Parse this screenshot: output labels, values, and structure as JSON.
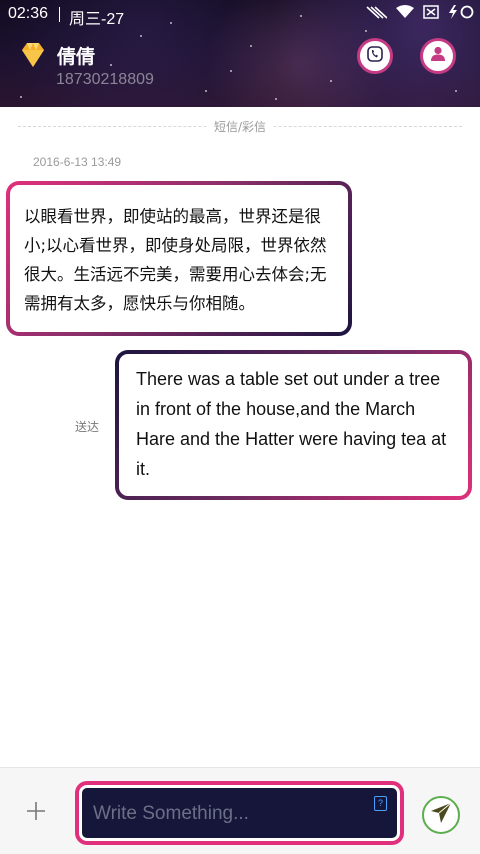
{
  "status_bar": {
    "time": "02:36",
    "date": "周三-27",
    "icons": [
      "signal-icon",
      "wifi-icon",
      "sim-card-icon",
      "charging-battery-icon"
    ]
  },
  "header": {
    "contact_name": "倩倩",
    "contact_number": "18730218809",
    "actions": [
      "phone-icon",
      "contact-profile-icon"
    ]
  },
  "conversation": {
    "section_label": "短信/彩信",
    "timestamp": "2016-6-13 13:49",
    "messages": [
      {
        "direction": "incoming",
        "text": "以眼看世界，即使站的最高，世界还是很小;以心看世界，即使身处局限，世界依然很大。生活远不完美，需要用心去体会;无需拥有太多，愿快乐与你相随。"
      },
      {
        "direction": "outgoing",
        "text": "There was a table set out under a tree in front of the house,and the March Hare and the Hatter were having tea at it.",
        "status": "送达"
      }
    ]
  },
  "input_bar": {
    "placeholder": "Write Something...",
    "emoji_glyph": "?",
    "add_icon": "plus-icon",
    "send_icon": "send-arrow-icon"
  },
  "colors": {
    "accent": "#e0307c",
    "bubble_dark": "#1c1440",
    "send_ring": "#5cae4e",
    "header_bg": "#1d1230"
  }
}
